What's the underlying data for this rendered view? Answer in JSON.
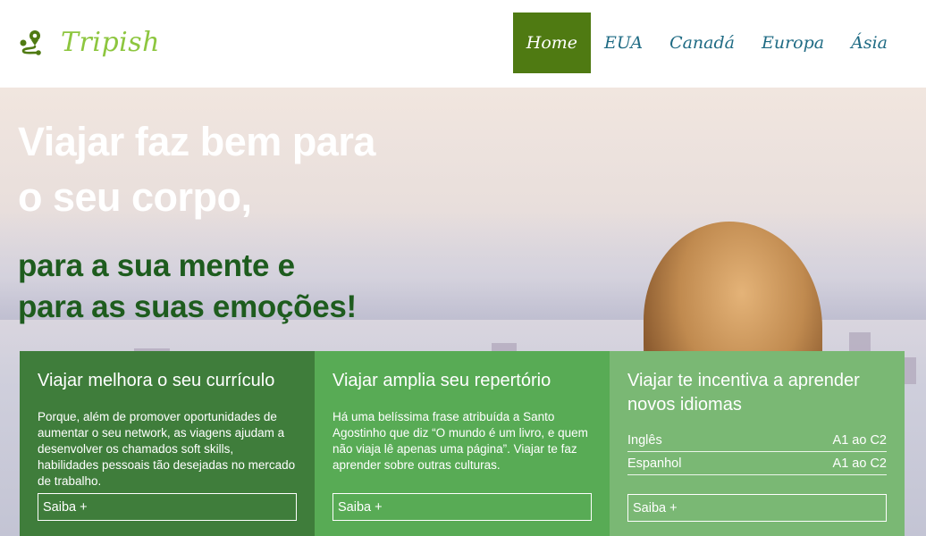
{
  "brand": {
    "name": "Tripish"
  },
  "nav": {
    "items": [
      {
        "label": "Home",
        "active": true
      },
      {
        "label": "EUA",
        "active": false
      },
      {
        "label": "Canadá",
        "active": false
      },
      {
        "label": "Europa",
        "active": false
      },
      {
        "label": "Ásia",
        "active": false
      }
    ]
  },
  "hero": {
    "headline_line1": "Viajar faz bem para",
    "headline_line2": "o seu corpo,",
    "subheadline_line1": "para a sua mente e",
    "subheadline_line2": "para as suas emoções!"
  },
  "cards": [
    {
      "title": "Viajar melhora o seu currículo",
      "text": "Porque, além de promover oportunidades de aumentar o seu network, as viagens ajudam a desenvolver os chamados soft skills, habilidades pessoais tão desejadas no mercado de trabalho.",
      "button": "Saiba +"
    },
    {
      "title": "Viajar amplia seu repertório",
      "text": "Há uma belíssima frase atribuída a Santo Agostinho que diz “O mundo é um livro, e quem não viaja lê apenas uma página”. Viajar te faz aprender sobre outras culturas.",
      "button": "Saiba +"
    },
    {
      "title": "Viajar te incentiva a aprender novos idiomas",
      "languages": [
        {
          "name": "Inglês",
          "level": "A1 ao C2"
        },
        {
          "name": "Espanhol",
          "level": "A1 ao C2"
        }
      ],
      "button": "Saiba +"
    }
  ],
  "colors": {
    "brand_green": "#8dc63f",
    "nav_active_bg": "#4f7a12",
    "nav_text": "#1f6b84",
    "headline_dark_green": "#1e5c1e",
    "card1_bg": "#3f7d3b",
    "card2_bg": "#58ab55",
    "card3_bg": "#7ab874"
  },
  "icons": {
    "logo": "route-pin-icon"
  }
}
